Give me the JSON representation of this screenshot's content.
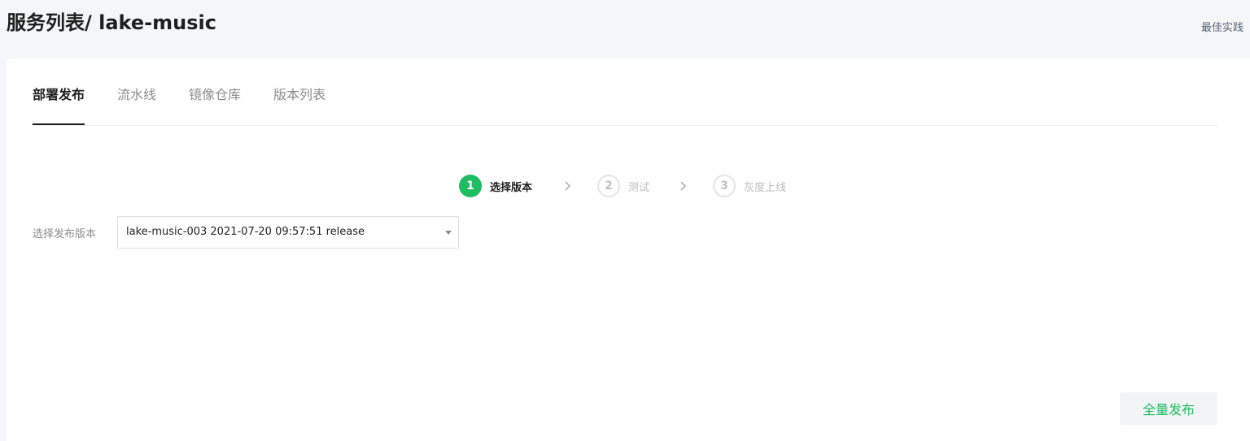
{
  "header": {
    "title_prefix": "服务列表/ ",
    "title_service": "lake-music",
    "best_practice_link": "最佳实践"
  },
  "tabs": [
    {
      "label": "部署发布",
      "active": true
    },
    {
      "label": "流水线",
      "active": false
    },
    {
      "label": "镜像仓库",
      "active": false
    },
    {
      "label": "版本列表",
      "active": false
    }
  ],
  "steps": [
    {
      "number": "1",
      "label": "选择版本",
      "status": "current"
    },
    {
      "number": "2",
      "label": "测试",
      "status": "pending"
    },
    {
      "number": "3",
      "label": "灰度上线",
      "status": "pending"
    }
  ],
  "form": {
    "version_label": "选择发布版本",
    "version_value": "lake-music-003 2021-07-20 09:57:51 release"
  },
  "actions": {
    "full_publish": "全量发布"
  },
  "colors": {
    "accent": "#1ebd61",
    "background": "#f5f6f7"
  }
}
